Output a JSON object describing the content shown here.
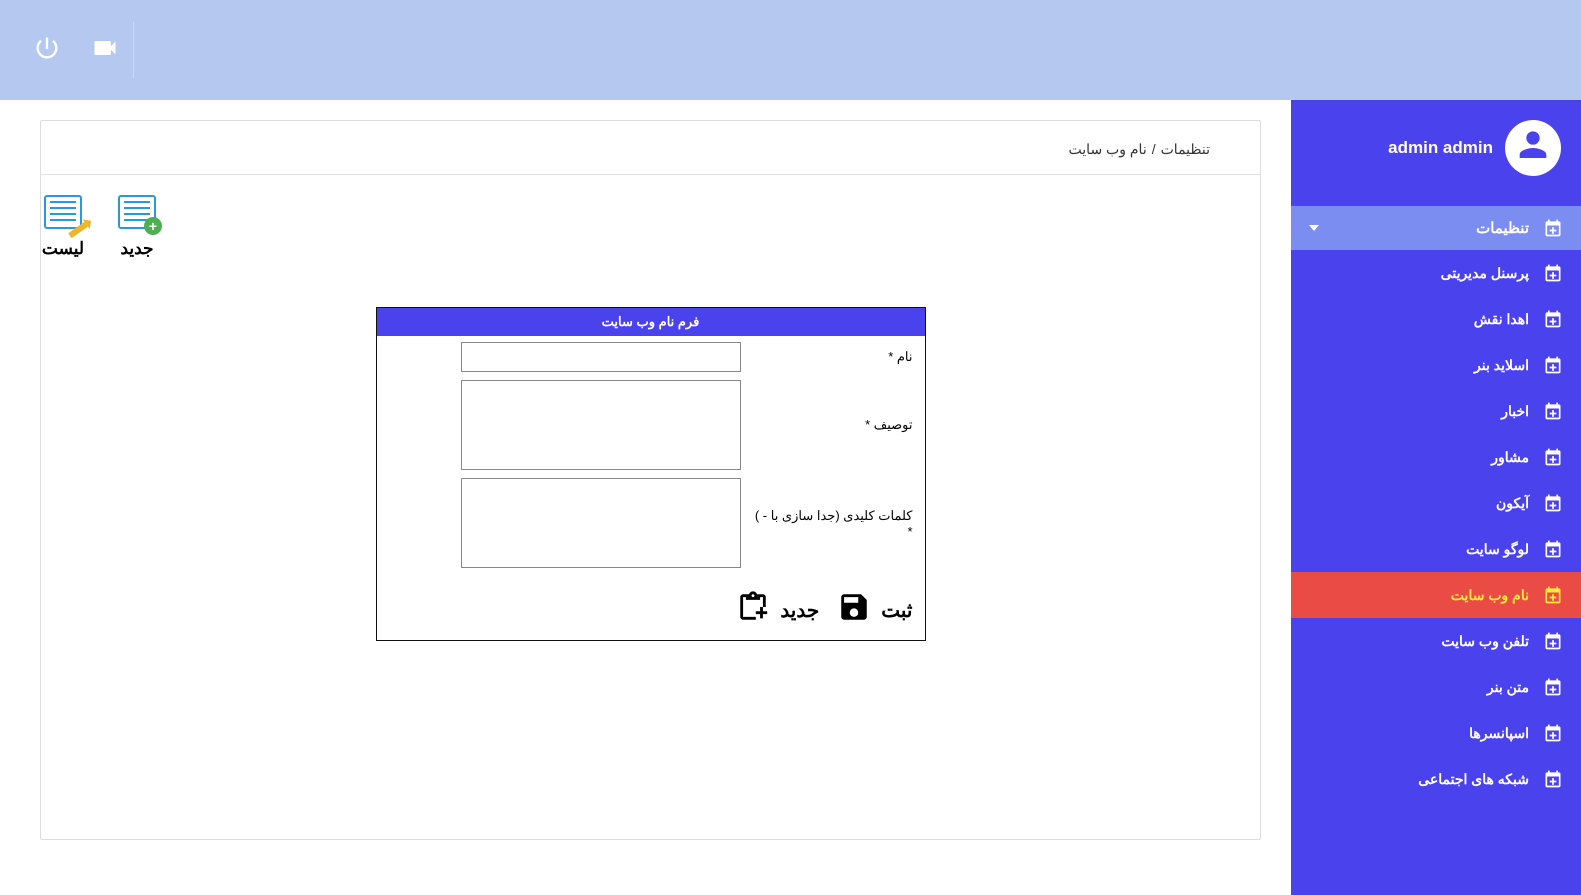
{
  "topbar": {
    "power_icon": "power",
    "video_icon": "video"
  },
  "user": {
    "name": "admin admin"
  },
  "nav": {
    "header": "تنظیمات",
    "items": [
      {
        "label": "پرسنل مدیریتی",
        "active": false
      },
      {
        "label": "اهدا نقش",
        "active": false
      },
      {
        "label": "اسلاید بنر",
        "active": false
      },
      {
        "label": "اخبار",
        "active": false
      },
      {
        "label": "مشاور",
        "active": false
      },
      {
        "label": "آیکون",
        "active": false
      },
      {
        "label": "لوگو سایت",
        "active": false
      },
      {
        "label": "نام وب سایت",
        "active": true
      },
      {
        "label": "تلفن وب سایت",
        "active": false
      },
      {
        "label": "متن بنر",
        "active": false
      },
      {
        "label": "اسپانسرها",
        "active": false
      },
      {
        "label": "شبکه های اجتماعی",
        "active": false
      }
    ]
  },
  "breadcrumb": {
    "root": "تنظیمات",
    "sep": "/",
    "current": "نام وب سایت"
  },
  "toolbar": {
    "list": "لیست",
    "new": "جدید"
  },
  "form": {
    "title": "فرم نام وب سایت",
    "name_label": "نام *",
    "name_value": "",
    "desc_label": "توصیف *",
    "desc_value": "",
    "keywords_label": "کلمات کلیدی (جدا سازی با - ) *",
    "keywords_value": "",
    "submit": "ثبت",
    "new": "جدید"
  }
}
